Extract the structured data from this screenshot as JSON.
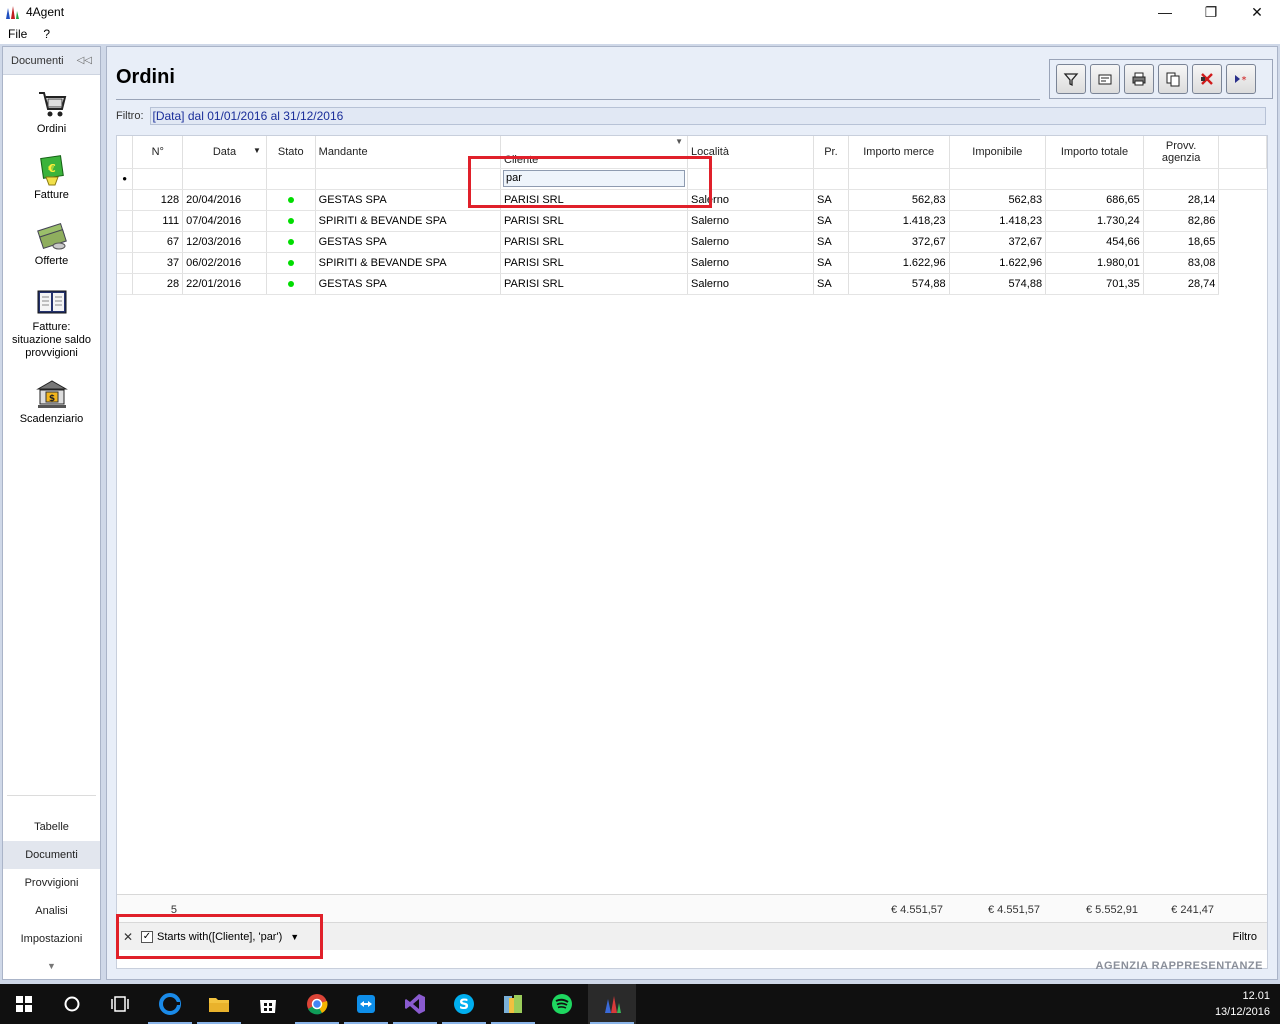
{
  "window": {
    "title": "4Agent"
  },
  "menu": [
    {
      "label": "File"
    },
    {
      "label": "?"
    }
  ],
  "sidebar": {
    "header": "Documenti",
    "items": [
      {
        "label": "Ordini",
        "icon": "shopping-cart-icon"
      },
      {
        "label": "Fatture",
        "icon": "money-icon"
      },
      {
        "label": "Offerte",
        "icon": "coins-icon"
      },
      {
        "label": "Fatture: situazione saldo provvigioni",
        "icon": "ledger-icon"
      },
      {
        "label": "Scadenziario",
        "icon": "bank-icon"
      }
    ],
    "bottom": [
      {
        "label": "Tabelle"
      },
      {
        "label": "Documenti",
        "active": true
      },
      {
        "label": "Provvigioni"
      },
      {
        "label": "Analisi"
      },
      {
        "label": "Impostazioni"
      }
    ]
  },
  "main": {
    "title": "Ordini",
    "filter_label": "Filtro:",
    "filter_value": "[Data] dal 01/01/2016 al 31/12/2016"
  },
  "toolbar": [
    {
      "icon": "filter-icon"
    },
    {
      "icon": "card-icon"
    },
    {
      "icon": "print-icon"
    },
    {
      "icon": "copy-icon"
    },
    {
      "icon": "delete-icon"
    },
    {
      "icon": "new-record-icon"
    }
  ],
  "grid": {
    "columns": [
      {
        "label": "N°"
      },
      {
        "label": "Data"
      },
      {
        "label": "Stato"
      },
      {
        "label": "Mandante"
      },
      {
        "label": "Cliente"
      },
      {
        "label": "Località"
      },
      {
        "label": "Pr."
      },
      {
        "label": "Importo merce"
      },
      {
        "label": "Imponibile"
      },
      {
        "label": "Importo totale"
      },
      {
        "label": "Provv. agenzia"
      }
    ],
    "autofilter_cliente": "par",
    "rows": [
      {
        "n": "128",
        "data": "20/04/2016",
        "mandante": "GESTAS SPA",
        "cliente": "PARISI SRL",
        "localita": "Salerno",
        "pr": "SA",
        "importo_merce": "562,83",
        "imponibile": "562,83",
        "importo_totale": "686,65",
        "provv": "28,14"
      },
      {
        "n": "111",
        "data": "07/04/2016",
        "mandante": "SPIRITI & BEVANDE SPA",
        "cliente": "PARISI SRL",
        "localita": "Salerno",
        "pr": "SA",
        "importo_merce": "1.418,23",
        "imponibile": "1.418,23",
        "importo_totale": "1.730,24",
        "provv": "82,86"
      },
      {
        "n": "67",
        "data": "12/03/2016",
        "mandante": "GESTAS SPA",
        "cliente": "PARISI SRL",
        "localita": "Salerno",
        "pr": "SA",
        "importo_merce": "372,67",
        "imponibile": "372,67",
        "importo_totale": "454,66",
        "provv": "18,65"
      },
      {
        "n": "37",
        "data": "06/02/2016",
        "mandante": "SPIRITI & BEVANDE SPA",
        "cliente": "PARISI SRL",
        "localita": "Salerno",
        "pr": "SA",
        "importo_merce": "1.622,96",
        "imponibile": "1.622,96",
        "importo_totale": "1.980,01",
        "provv": "83,08"
      },
      {
        "n": "28",
        "data": "22/01/2016",
        "mandante": "GESTAS SPA",
        "cliente": "PARISI SRL",
        "localita": "Salerno",
        "pr": "SA",
        "importo_merce": "574,88",
        "imponibile": "574,88",
        "importo_totale": "701,35",
        "provv": "28,74"
      }
    ],
    "totals": {
      "count": "5",
      "importo_merce": "€ 4.551,57",
      "imponibile": "€ 4.551,57",
      "importo_totale": "€ 5.552,91",
      "provv": "€ 241,47"
    },
    "filter_panel": {
      "expression": "Starts with([Cliente], 'par')",
      "edit_label": "Filtro"
    }
  },
  "brand": "AGENZIA RAPPRESENTANZE",
  "taskbar": {
    "time": "12.01",
    "date": "13/12/2016",
    "apps": [
      "windows-start-icon",
      "search-circle-icon",
      "task-view-icon",
      "edge-icon",
      "file-explorer-icon",
      "store-icon",
      "chrome-icon",
      "teamviewer-icon",
      "visual-studio-icon",
      "skype-icon",
      "archive-icon",
      "spotify-icon",
      "4agent-app-icon"
    ]
  },
  "colors": {
    "highlight_box": "#e0202a",
    "status_active": "#00dd00",
    "filter_text": "#1a2e9a"
  }
}
